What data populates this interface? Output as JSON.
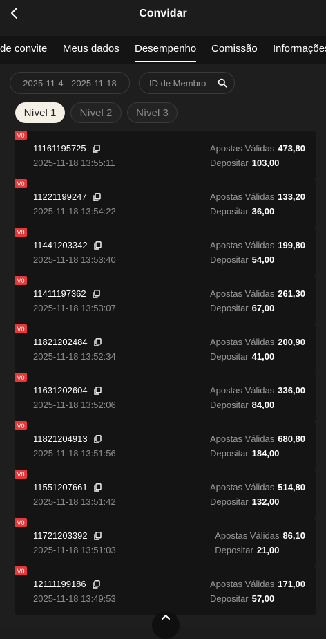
{
  "header": {
    "title": "Convidar"
  },
  "tabs": [
    {
      "label": "de convite"
    },
    {
      "label": "Meus dados"
    },
    {
      "label": "Desempenho",
      "active": true
    },
    {
      "label": "Comissão"
    },
    {
      "label": "Informações"
    }
  ],
  "filters": {
    "date_range": "2025-11-4 - 2025-11-18",
    "member_placeholder": "ID de Membro"
  },
  "levels": [
    {
      "label": "Nível 1",
      "active": true
    },
    {
      "label": "Nível 2"
    },
    {
      "label": "Nível 3"
    }
  ],
  "labels": {
    "bets": "Apostas Válidas",
    "deposit": "Depositar"
  },
  "records": [
    {
      "badge": "V0",
      "id": "11161195725",
      "time": "2025-11-18 13:55:11",
      "bets": "473,80",
      "deposit": "103,00"
    },
    {
      "badge": "V0",
      "id": "11221199247",
      "time": "2025-11-18 13:54:22",
      "bets": "133,20",
      "deposit": "36,00"
    },
    {
      "badge": "V0",
      "id": "11441203342",
      "time": "2025-11-18 13:53:40",
      "bets": "199,80",
      "deposit": "54,00"
    },
    {
      "badge": "V0",
      "id": "11411197362",
      "time": "2025-11-18 13:53:07",
      "bets": "261,30",
      "deposit": "67,00"
    },
    {
      "badge": "V0",
      "id": "11821202484",
      "time": "2025-11-18 13:52:34",
      "bets": "200,90",
      "deposit": "41,00"
    },
    {
      "badge": "V0",
      "id": "11631202604",
      "time": "2025-11-18 13:52:06",
      "bets": "336,00",
      "deposit": "84,00"
    },
    {
      "badge": "V0",
      "id": "11821204913",
      "time": "2025-11-18 13:51:56",
      "bets": "680,80",
      "deposit": "184,00"
    },
    {
      "badge": "V0",
      "id": "11551207661",
      "time": "2025-11-18 13:51:42",
      "bets": "514,80",
      "deposit": "132,00"
    },
    {
      "badge": "V0",
      "id": "11721203392",
      "time": "2025-11-18 13:51:03",
      "bets": "86,10",
      "deposit": "21,00"
    },
    {
      "badge": "V0",
      "id": "12111199186",
      "time": "2025-11-18 13:49:53",
      "bets": "171,00",
      "deposit": "57,00"
    }
  ],
  "colors": {
    "badge": "#e5383b",
    "active_level_bg": "#f5f0e6",
    "card_bg": "#141414",
    "page_bg": "#1e1e1e"
  },
  "icons": {
    "back": "chevron-left-icon",
    "search": "search-icon",
    "copy": "copy-icon",
    "scroll_top": "chevron-up-icon"
  }
}
